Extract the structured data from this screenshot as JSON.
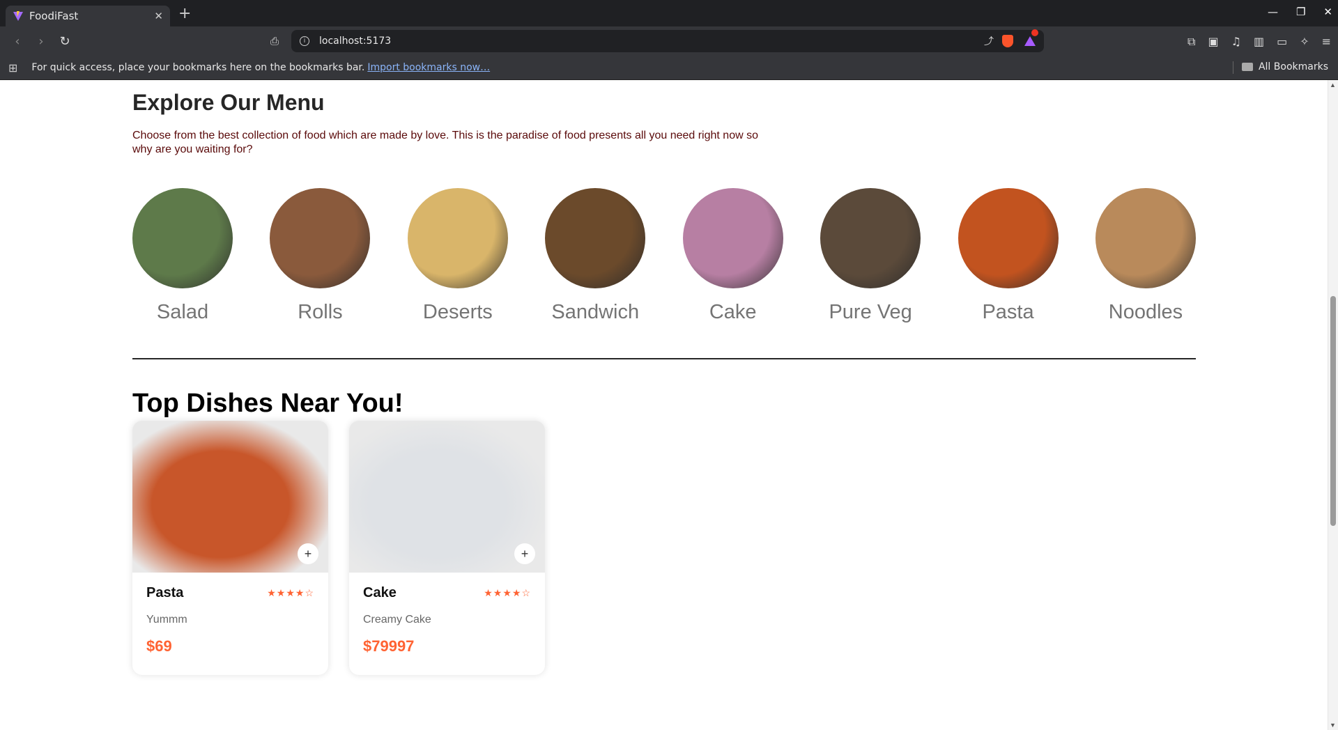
{
  "browser": {
    "tab_title": "FoodiFast",
    "tab_close": "✕",
    "new_tab": "+",
    "url": "localhost:5173",
    "bookmarks_message": "For quick access, place your bookmarks here on the bookmarks bar.",
    "import_link": "Import bookmarks now…",
    "all_bookmarks": "All Bookmarks",
    "window_controls": {
      "minimize": "—",
      "restore": "❐",
      "close": "✕"
    }
  },
  "menu": {
    "title": "Explore Our Menu",
    "description": "Choose from the best collection of food which are made by love. This is the paradise of food presents all you need right now so why are you waiting for?",
    "categories": [
      {
        "label": "Salad",
        "color": "#5e7a4a"
      },
      {
        "label": "Rolls",
        "color": "#8a5a3c"
      },
      {
        "label": "Deserts",
        "color": "#d9b56a"
      },
      {
        "label": "Sandwich",
        "color": "#6b4a2b"
      },
      {
        "label": "Cake",
        "color": "#b77fa3"
      },
      {
        "label": "Pure Veg",
        "color": "#5b4a3a"
      },
      {
        "label": "Pasta",
        "color": "#c2531f"
      },
      {
        "label": "Noodles",
        "color": "#b98a5b"
      }
    ]
  },
  "top_dishes": {
    "title": "Top Dishes Near You!",
    "items": [
      {
        "name": "Pasta",
        "description": "Yummm",
        "price": "$69",
        "rating": 4,
        "stars": "★★★★☆",
        "photo_color": "#c8562a"
      },
      {
        "name": "Cake",
        "description": "Creamy Cake",
        "price": "$79997",
        "rating": 4,
        "stars": "★★★★☆",
        "photo_color": "#dfe2e6"
      }
    ],
    "add_label": "+"
  },
  "colors": {
    "accent": "#ff6333",
    "description_text": "#5a0a0a"
  }
}
